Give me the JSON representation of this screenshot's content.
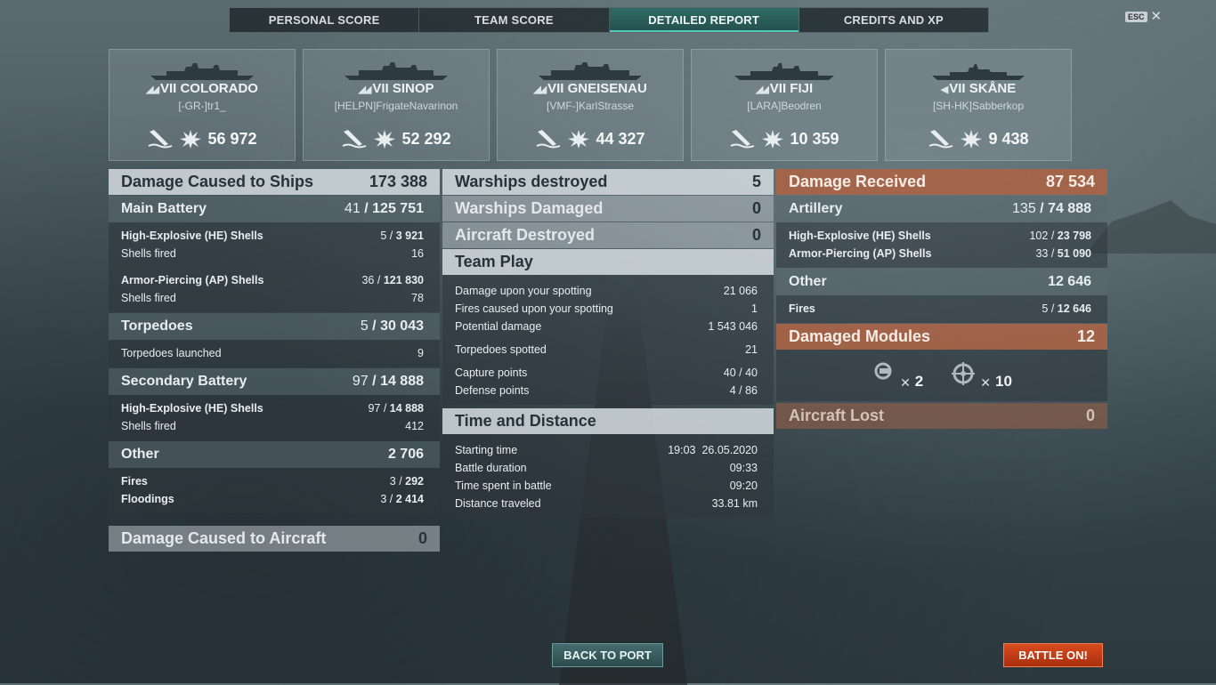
{
  "tabs": [
    "PERSONAL SCORE",
    "TEAM SCORE",
    "DETAILED REPORT",
    "CREDITS AND XP"
  ],
  "active_tab": "DETAILED REPORT",
  "esc": {
    "key": "ESC",
    "close": "✕"
  },
  "ships": [
    {
      "tier": "VII",
      "name": "COLORADO",
      "player": "[-GR-]tr1_",
      "damage": "56 972"
    },
    {
      "tier": "VII",
      "name": "SINOP",
      "player": "[HELPN]FrigateNavarinon",
      "damage": "52 292"
    },
    {
      "tier": "VII",
      "name": "GNEISENAU",
      "player": "[VMF-]KarlStrasse",
      "damage": "44 327"
    },
    {
      "tier": "VII",
      "name": "FIJI",
      "player": "[LARA]Beodren",
      "damage": "10 359"
    },
    {
      "tier": "VII",
      "name": "SKÅNE",
      "player": "[SH-HK]Sabberkop",
      "damage": "9 438"
    }
  ],
  "left": {
    "damage_caused": {
      "label": "Damage Caused to Ships",
      "value": "173 388"
    },
    "main_battery": {
      "label": "Main Battery",
      "hits": "41",
      "damage": "125 751"
    },
    "he_shells": {
      "label": "High-Explosive (HE) Shells",
      "hits": "5",
      "damage": "3 921"
    },
    "he_fired": {
      "label": "Shells fired",
      "value": "16"
    },
    "ap_shells": {
      "label": "Armor-Piercing (AP) Shells",
      "hits": "36",
      "damage": "121 830"
    },
    "ap_fired": {
      "label": "Shells fired",
      "value": "78"
    },
    "torpedoes": {
      "label": "Torpedoes",
      "hits": "5",
      "damage": "30 043"
    },
    "torp_launched": {
      "label": "Torpedoes launched",
      "value": "9"
    },
    "secondary": {
      "label": "Secondary Battery",
      "hits": "97",
      "damage": "14 888"
    },
    "sec_he": {
      "label": "High-Explosive (HE) Shells",
      "hits": "97",
      "damage": "14 888"
    },
    "sec_fired": {
      "label": "Shells fired",
      "value": "412"
    },
    "other": {
      "label": "Other",
      "value": "2 706"
    },
    "fires": {
      "label": "Fires",
      "hits": "3",
      "damage": "292"
    },
    "floodings": {
      "label": "Floodings",
      "hits": "3",
      "damage": "2 414"
    },
    "aircraft": {
      "label": "Damage Caused to Aircraft",
      "value": "0"
    }
  },
  "middle": {
    "destroyed": {
      "label": "Warships destroyed",
      "value": "5"
    },
    "damaged": {
      "label": "Warships Damaged",
      "value": "0"
    },
    "aircraft_destroyed": {
      "label": "Aircraft Destroyed",
      "value": "0"
    },
    "team_play": "Team Play",
    "spotting_dmg": {
      "label": "Damage upon your spotting",
      "value": "21 066"
    },
    "spotting_fires": {
      "label": "Fires caused upon your spotting",
      "value": "1"
    },
    "potential": {
      "label": "Potential damage",
      "value": "1 543 046"
    },
    "torp_spotted": {
      "label": "Torpedoes spotted",
      "value": "21"
    },
    "capture": {
      "label": "Capture points",
      "value": "40 / 40"
    },
    "defense": {
      "label": "Defense points",
      "value": "4 / 86"
    },
    "time_distance": "Time and Distance",
    "start": {
      "label": "Starting time",
      "time": "19:03",
      "date": "26.05.2020"
    },
    "duration": {
      "label": "Battle duration",
      "value": "09:33"
    },
    "spent": {
      "label": "Time spent in battle",
      "value": "09:20"
    },
    "distance": {
      "label": "Distance traveled",
      "value": "33.81 km"
    }
  },
  "right": {
    "received": {
      "label": "Damage Received",
      "value": "87 534"
    },
    "artillery": {
      "label": "Artillery",
      "hits": "135",
      "damage": "74 888"
    },
    "he": {
      "label": "High-Explosive (HE) Shells",
      "hits": "102",
      "damage": "23 798"
    },
    "ap": {
      "label": "Armor-Piercing (AP) Shells",
      "hits": "33",
      "damage": "51 090"
    },
    "other": {
      "label": "Other",
      "value": "12 646"
    },
    "fires": {
      "label": "Fires",
      "hits": "5",
      "damage": "12 646"
    },
    "modules": {
      "label": "Damaged Modules",
      "value": "12"
    },
    "module_items": [
      {
        "icon": "engine-module-icon",
        "mult": "✕",
        "count": "2"
      },
      {
        "icon": "steering-module-icon",
        "mult": "✕",
        "count": "10"
      }
    ],
    "aircraft_lost": {
      "label": "Aircraft Lost",
      "value": "0"
    }
  },
  "buttons": {
    "back": "BACK TO PORT",
    "battle": "BATTLE ON!"
  }
}
